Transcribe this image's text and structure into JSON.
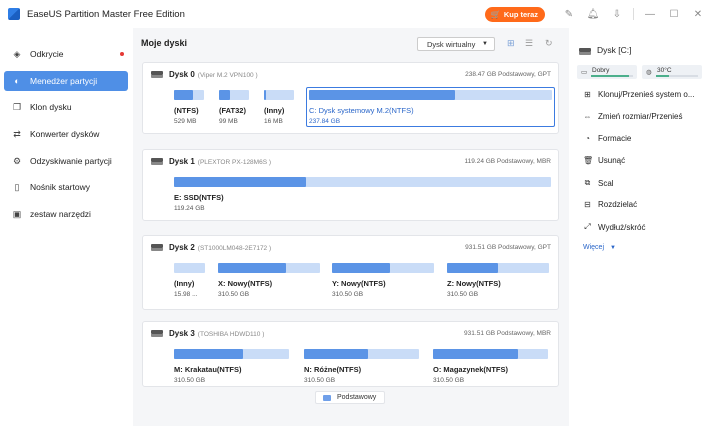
{
  "app": {
    "title": "EaseUS Partition Master Free Edition",
    "buy_label": "Kup teraz"
  },
  "sidebar": {
    "items": [
      {
        "label": "Odkrycie",
        "icon": "compass-icon",
        "badge": true
      },
      {
        "label": "Menedżer partycji",
        "icon": "partition-icon",
        "active": true
      },
      {
        "label": "Klon dysku",
        "icon": "clone-icon"
      },
      {
        "label": "Konwerter dysków",
        "icon": "convert-icon"
      },
      {
        "label": "Odzyskiwanie partycji",
        "icon": "recovery-icon"
      },
      {
        "label": "Nośnik startowy",
        "icon": "usb-icon"
      },
      {
        "label": "zestaw narzędzi",
        "icon": "toolkit-icon"
      }
    ]
  },
  "main": {
    "title": "Moje dyski",
    "view_select": "Dysk wirtualny",
    "legend": {
      "label": "Podstawowy",
      "color": "#6f9fe9"
    },
    "disks": [
      {
        "name": "Dysk 0",
        "model": "(Viper M.2 VPN100 )",
        "info": "238.47 GB Podstawowy, GPT",
        "partitions": [
          {
            "name": "(NTFS)",
            "size": "529 MB",
            "used": 0.62
          },
          {
            "name": "(FAT32)",
            "size": "99 MB",
            "used": 0.35
          },
          {
            "name": "(Inny)",
            "size": "16 MB",
            "used": 0.05
          },
          {
            "name": "C: Dysk systemowy M.2(NTFS)",
            "size": "237.84 GB",
            "used": 0.6,
            "selected": true
          }
        ]
      },
      {
        "name": "Dysk 1",
        "model": "(PLEXTOR PX-128M6S )",
        "info": "119.24 GB Podstawowy, MBR",
        "partitions": [
          {
            "name": "E: SSD(NTFS)",
            "size": "119.24 GB",
            "used": 0.35
          }
        ]
      },
      {
        "name": "Dysk 2",
        "model": "(ST1000LM048-2E7172 )",
        "info": "931.51 GB Podstawowy, GPT",
        "partitions": [
          {
            "name": "(Inny)",
            "size": "15.98 ...",
            "used": 0.0
          },
          {
            "name": "X: Nowy(NTFS)",
            "size": "310.50 GB",
            "used": 0.67
          },
          {
            "name": "Y: Nowy(NTFS)",
            "size": "310.50 GB",
            "used": 0.57
          },
          {
            "name": "Z: Nowy(NTFS)",
            "size": "310.50 GB",
            "used": 0.5
          }
        ]
      },
      {
        "name": "Dysk 3",
        "model": "(TOSHIBA HDWD110 )",
        "info": "931.51 GB Podstawowy, MBR",
        "partitions": [
          {
            "name": "M: Krakatau(NTFS)",
            "size": "310.50 GB",
            "used": 0.6
          },
          {
            "name": "N: Różne(NTFS)",
            "size": "310.50 GB",
            "used": 0.56
          },
          {
            "name": "O: Magazynek(NTFS)",
            "size": "310.50 GB",
            "used": 0.74
          }
        ]
      }
    ]
  },
  "rpanel": {
    "title": "Dysk [C:]",
    "health": {
      "label": "Dobry",
      "level": 0.9
    },
    "temp": {
      "label": "30°C",
      "level": 0.3
    },
    "actions": [
      {
        "label": "Klonuj/Przenieś system o...",
        "icon": "windows-icon"
      },
      {
        "label": "Zmień rozmiar/Przenieś",
        "icon": "resize-icon"
      },
      {
        "label": "Formacie",
        "icon": "format-icon"
      },
      {
        "label": "Usunąć",
        "icon": "trash-icon"
      },
      {
        "label": "Scal",
        "icon": "merge-icon"
      },
      {
        "label": "Rozdzielać",
        "icon": "split-icon"
      },
      {
        "label": "Wydłuż/skróć",
        "icon": "extend-icon"
      }
    ],
    "more_label": "Więcej"
  }
}
